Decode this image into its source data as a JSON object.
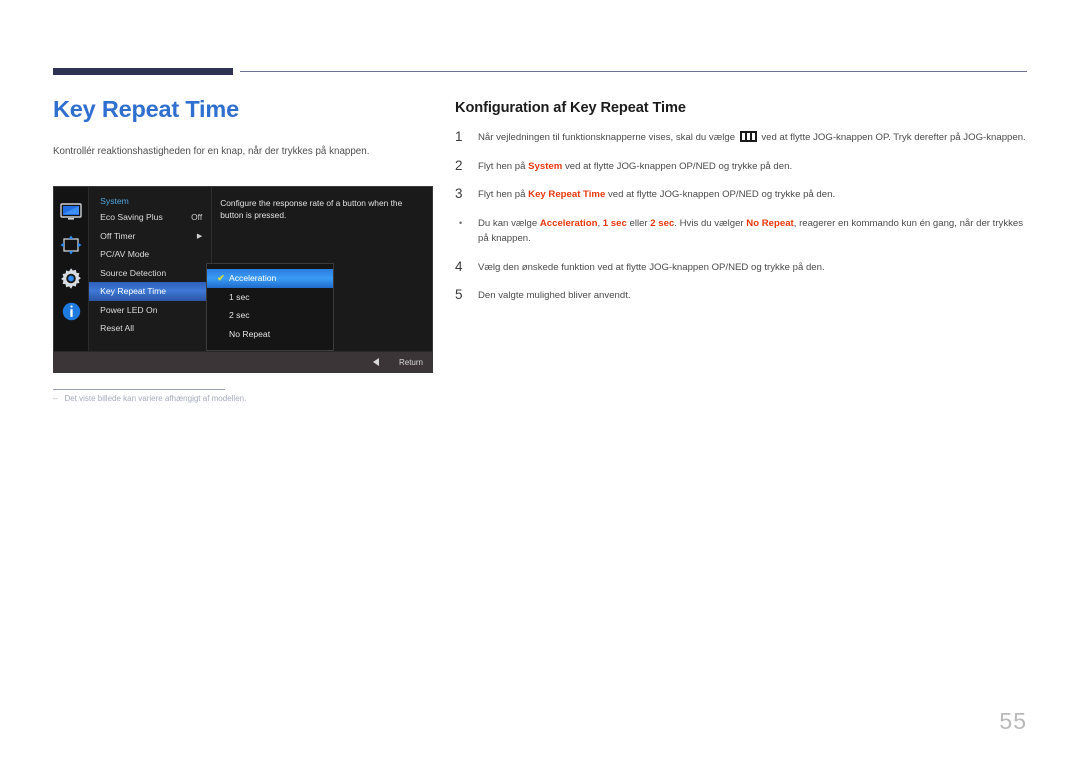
{
  "page": {
    "number": "55"
  },
  "left": {
    "title": "Key Repeat Time",
    "description": "Kontrollér reaktionshastigheden for en knap, når der trykkes på knappen.",
    "footnote_dash": "‒",
    "footnote": "Det viste billede kan variere afhængigt af modellen."
  },
  "osd": {
    "menu_title": "System",
    "icons": [
      {
        "name": "monitor-icon",
        "label": "Picture"
      },
      {
        "name": "screen-adjust-icon",
        "label": "OnScreen Display"
      },
      {
        "name": "gear-icon",
        "label": "System"
      },
      {
        "name": "info-icon",
        "label": "Information"
      }
    ],
    "rows": [
      {
        "label": "Eco Saving Plus",
        "value": "Off",
        "arrow": "",
        "selected": false
      },
      {
        "label": "Off Timer",
        "value": "",
        "arrow": "▶",
        "selected": false
      },
      {
        "label": "PC/AV Mode",
        "value": "",
        "arrow": "",
        "selected": false
      },
      {
        "label": "Source Detection",
        "value": "",
        "arrow": "",
        "selected": false
      },
      {
        "label": "Key Repeat Time",
        "value": "",
        "arrow": "",
        "selected": true
      },
      {
        "label": "Power LED On",
        "value": "",
        "arrow": "",
        "selected": false
      },
      {
        "label": "Reset All",
        "value": "",
        "arrow": "",
        "selected": false
      }
    ],
    "submenu": [
      {
        "label": "Acceleration",
        "check": "✔",
        "selected": true
      },
      {
        "label": "1 sec",
        "check": "",
        "selected": false
      },
      {
        "label": "2 sec",
        "check": "",
        "selected": false
      },
      {
        "label": "No Repeat",
        "check": "",
        "selected": false
      }
    ],
    "description": "Configure the response rate of a button when the button is pressed.",
    "footer_return": "Return"
  },
  "right": {
    "section_title": "Konfiguration af Key Repeat Time",
    "steps": [
      {
        "num": "1",
        "parts": [
          {
            "t": "Når vejledningen til funktionsknapperne vises, skal du vælge ",
            "s": "plain"
          },
          {
            "t": "",
            "s": "menu-glyph"
          },
          {
            "t": " ved at flytte JOG-knappen OP. Tryk derefter på JOG-knappen.",
            "s": "plain"
          }
        ]
      },
      {
        "num": "2",
        "parts": [
          {
            "t": "Flyt hen på ",
            "s": "plain"
          },
          {
            "t": "System",
            "s": "hl"
          },
          {
            "t": " ved at flytte JOG-knappen OP/NED og trykke på den.",
            "s": "plain"
          }
        ]
      },
      {
        "num": "3",
        "parts": [
          {
            "t": "Flyt hen på ",
            "s": "plain"
          },
          {
            "t": "Key Repeat Time",
            "s": "hl"
          },
          {
            "t": " ved at flytte JOG-knappen OP/NED og trykke på den.",
            "s": "plain"
          }
        ]
      },
      {
        "num": "•",
        "bullet": true,
        "parts": [
          {
            "t": "Du kan vælge ",
            "s": "plain"
          },
          {
            "t": "Acceleration",
            "s": "hl"
          },
          {
            "t": ", ",
            "s": "plain"
          },
          {
            "t": "1 sec",
            "s": "hl"
          },
          {
            "t": " eller ",
            "s": "plain"
          },
          {
            "t": "2 sec",
            "s": "hl"
          },
          {
            "t": ". Hvis du vælger ",
            "s": "plain"
          },
          {
            "t": "No Repeat",
            "s": "hl"
          },
          {
            "t": ", reagerer en kommando kun én gang, når der trykkes på knappen.",
            "s": "plain"
          }
        ]
      },
      {
        "num": "4",
        "parts": [
          {
            "t": "Vælg den ønskede funktion ved at flytte JOG-knappen OP/NED og trykke på den.",
            "s": "plain"
          }
        ]
      },
      {
        "num": "5",
        "parts": [
          {
            "t": "Den valgte mulighed bliver anvendt.",
            "s": "plain"
          }
        ]
      }
    ]
  },
  "colors": {
    "title_blue": "#2f6fd0",
    "rule_navy": "#2e3356",
    "highlight_red": "#e8380d",
    "osd_select_blue": "#3a9bf5",
    "osd_menu_title_blue": "#52a7e0"
  }
}
